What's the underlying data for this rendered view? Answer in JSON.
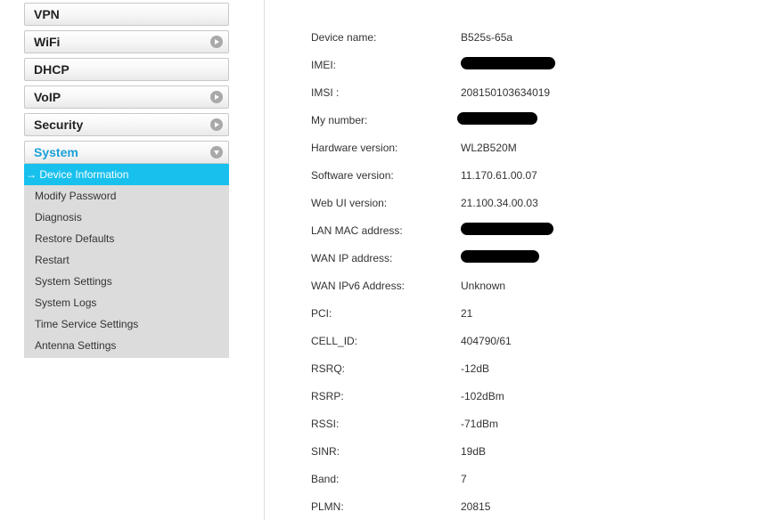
{
  "sidebar": {
    "items": [
      {
        "label": "VPN",
        "arrow": "none"
      },
      {
        "label": "WiFi",
        "arrow": "right"
      },
      {
        "label": "DHCP",
        "arrow": "none"
      },
      {
        "label": "VoIP",
        "arrow": "right"
      },
      {
        "label": "Security",
        "arrow": "right"
      },
      {
        "label": "System",
        "arrow": "down",
        "active": true
      }
    ],
    "submenu": [
      {
        "label": "→ Device Information",
        "selected": true
      },
      {
        "label": "Modify Password"
      },
      {
        "label": "Diagnosis"
      },
      {
        "label": "Restore Defaults"
      },
      {
        "label": "Restart"
      },
      {
        "label": "System Settings"
      },
      {
        "label": "System Logs"
      },
      {
        "label": "Time Service Settings"
      },
      {
        "label": "Antenna Settings"
      }
    ]
  },
  "device_info": {
    "rows": [
      {
        "key": "Device name:",
        "value": "B525s-65a"
      },
      {
        "key": "IMEI:",
        "value": "",
        "redacted": true
      },
      {
        "key": "IMSI :",
        "value": "208150103634019"
      },
      {
        "key": "My number:",
        "value": "",
        "redacted": true
      },
      {
        "key": "Hardware version:",
        "value": "WL2B520M"
      },
      {
        "key": "Software version:",
        "value": "11.170.61.00.07"
      },
      {
        "key": "Web UI version:",
        "value": "21.100.34.00.03"
      },
      {
        "key": "LAN MAC address:",
        "value": "",
        "redacted": true
      },
      {
        "key": "WAN IP address:",
        "value": "",
        "redacted": true
      },
      {
        "key": "WAN IPv6 Address:",
        "value": "Unknown"
      },
      {
        "key": "PCI:",
        "value": "21"
      },
      {
        "key": "CELL_ID:",
        "value": "404790/61"
      },
      {
        "key": "RSRQ:",
        "value": "-12dB"
      },
      {
        "key": "RSRP:",
        "value": "-102dBm"
      },
      {
        "key": "RSSI:",
        "value": "-71dBm"
      },
      {
        "key": "SINR:",
        "value": "19dB"
      },
      {
        "key": "Band:",
        "value": "7"
      },
      {
        "key": "PLMN:",
        "value": "20815"
      }
    ]
  },
  "colors": {
    "accent": "#1aa0d9",
    "selected_bg": "#18c0ee",
    "submenu_bg": "#dcdcdc"
  },
  "icons": {
    "arrow_right": "chevron-right-circle-icon",
    "arrow_down": "chevron-down-circle-icon",
    "redaction": "redaction-mark"
  }
}
